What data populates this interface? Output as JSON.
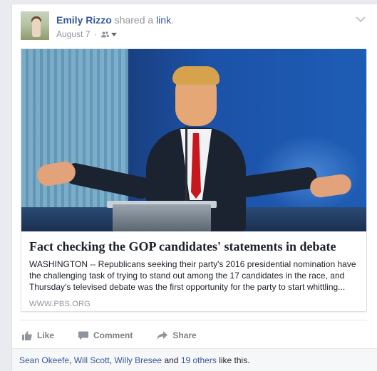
{
  "post": {
    "author": {
      "name": "Emily Rizzo",
      "verb": "shared a",
      "object": "link",
      "punct": "."
    },
    "meta": {
      "date": "August 7",
      "separator": "·",
      "audience_icon": "friends-icon",
      "dropdown_icon": "caret-down-icon"
    },
    "menu_icon": "chevron-down-icon"
  },
  "attachment": {
    "title": "Fact checking the GOP candidates' statements in debate",
    "description_lines": [
      "WASHINGTON -- Republicans seeking their party's 2016 presidential nomination have",
      "the challenging task of trying to stand out among the 17 candidates in the race, and",
      "Thursday's televised debate was the first opportunity for the party to start whittling..."
    ],
    "domain": "WWW.PBS.ORG"
  },
  "actions": {
    "like": "Like",
    "comment": "Comment",
    "share": "Share"
  },
  "likes": {
    "names": [
      "Sean Okeefe",
      "Will Scott",
      "Willy Bresee"
    ],
    "sep": ", ",
    "and": " and ",
    "others": "19 others",
    "suffix": " like this."
  },
  "colors": {
    "link_blue": "#365899",
    "muted_gray": "#90949c",
    "background": "#e9ebee"
  }
}
